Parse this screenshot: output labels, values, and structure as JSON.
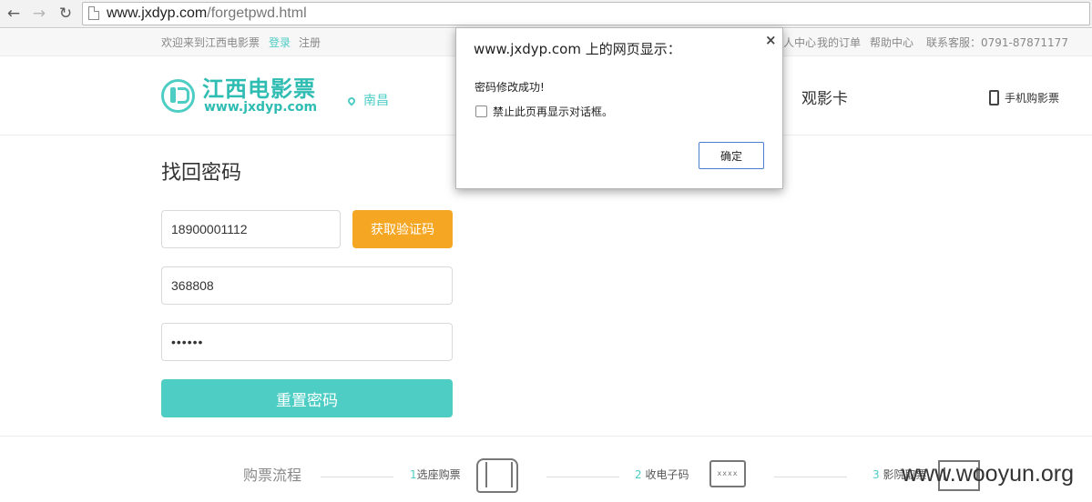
{
  "browser": {
    "back_icon": "back-arrow-icon",
    "forward_icon": "forward-arrow-icon",
    "reload_icon": "reload-icon",
    "url_host": "www.jxdyp.com",
    "url_path": "/forgetpwd.html"
  },
  "topbar": {
    "welcome": "欢迎来到江西电影票",
    "login": "登录",
    "register": "注册",
    "user_center_partial": "人中心",
    "my_orders": "我的订单",
    "help_center": "帮助中心",
    "service": "联系客服：0791-87871177"
  },
  "header": {
    "logo_cn": "江西电影票",
    "logo_en": "www.jxdyp.com",
    "city": "南昌",
    "nav_card": "观影卡",
    "mobile_tickets": "手机购影票"
  },
  "form": {
    "title": "找回密码",
    "phone_value": "18900001112",
    "get_code_label": "获取验证码",
    "code_value": "368808",
    "password_value": "••••••",
    "reset_label": "重置密码"
  },
  "process": {
    "title": "购票流程",
    "step1_num": "1",
    "step1_label": "选座购票",
    "step2_num": "2",
    "step2_label": "收电子码",
    "step3_num": "3",
    "step3_label": "影院取票",
    "sms_glyph": "xxxx"
  },
  "watermark": "www.wooyun.org",
  "dialog": {
    "title": "www.jxdyp.com 上的网页显示：",
    "close": "×",
    "message": "密码修改成功!",
    "checkbox_label": "禁止此页再显示对话框。",
    "ok_label": "确定"
  },
  "colors": {
    "accent": "#4ecdc4",
    "orange": "#f5a623"
  }
}
